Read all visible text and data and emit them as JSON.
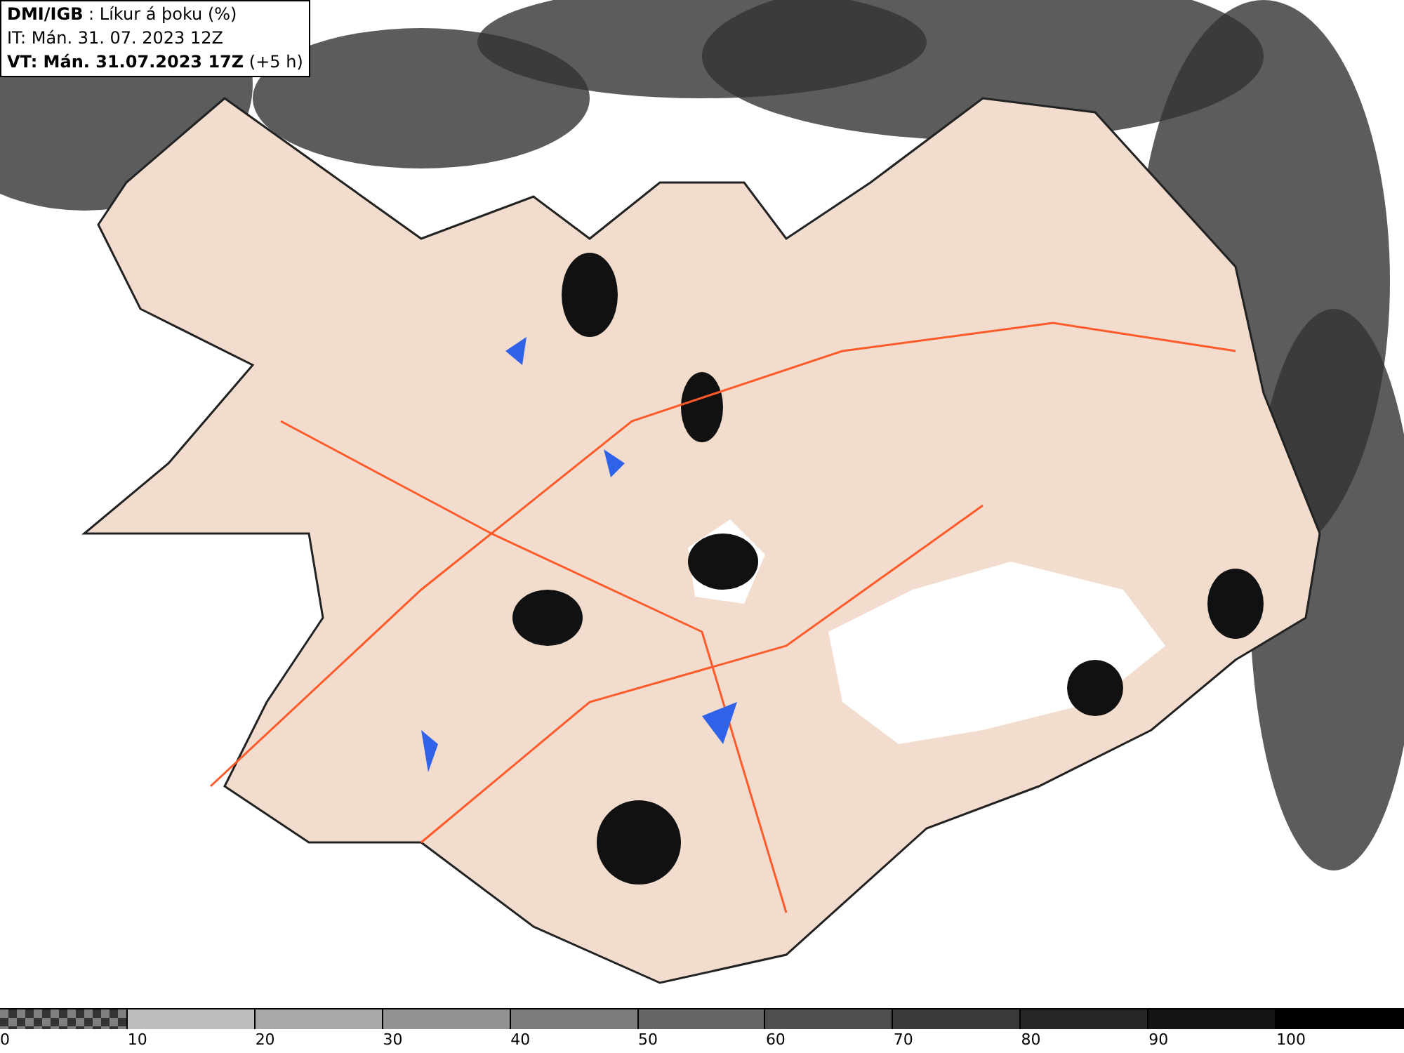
{
  "header": {
    "lines": [
      "**DMI/IGB** : Líkur á þoku (%)",
      "IT: Mán. 31. 07. 2023 12Z",
      "**VT: Mán. 31.07.2023 17Z** (+5 h)"
    ]
  },
  "legend": {
    "swatches": [
      {
        "kind": "checker",
        "color": "#7f7f7f",
        "label": "0"
      },
      {
        "kind": "solid",
        "color": "#bdbdbd",
        "label": "10"
      },
      {
        "kind": "solid",
        "color": "#a8a8a8",
        "label": "20"
      },
      {
        "kind": "solid",
        "color": "#939393",
        "label": "30"
      },
      {
        "kind": "solid",
        "color": "#7c7c7c",
        "label": "40"
      },
      {
        "kind": "solid",
        "color": "#646464",
        "label": "50"
      },
      {
        "kind": "solid",
        "color": "#4f4f4f",
        "label": "60"
      },
      {
        "kind": "solid",
        "color": "#3a3a3a",
        "label": "70"
      },
      {
        "kind": "solid",
        "color": "#262626",
        "label": "80"
      },
      {
        "kind": "solid",
        "color": "#141414",
        "label": "90"
      },
      {
        "kind": "solid",
        "color": "#000000",
        "label": "100"
      }
    ]
  }
}
